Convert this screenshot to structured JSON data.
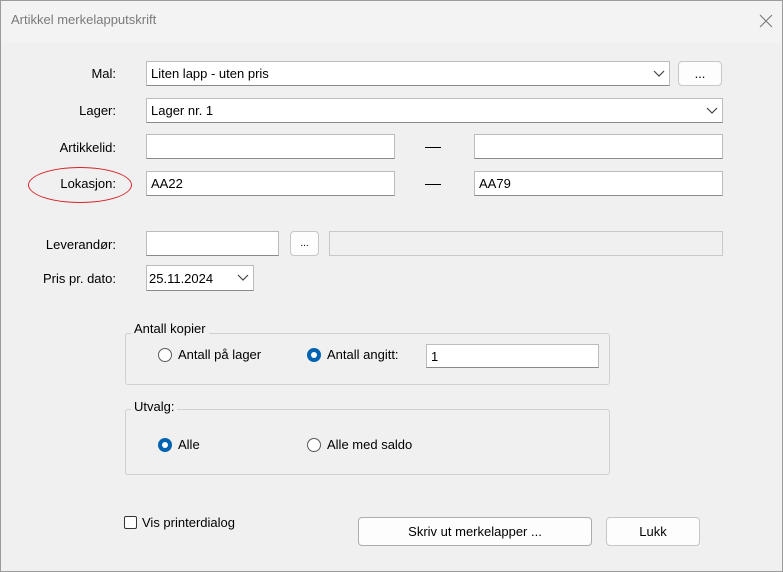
{
  "window": {
    "title": "Artikkel merkelapputskrift",
    "close_icon": "close-icon"
  },
  "form": {
    "mal": {
      "label": "Mal:",
      "value": "Liten lapp - uten pris",
      "browse_label": "..."
    },
    "lager": {
      "label": "Lager:",
      "value": "Lager nr. 1"
    },
    "artikkelid": {
      "label": "Artikkelid:",
      "from": "",
      "to": ""
    },
    "lokasjon": {
      "label": "Lokasjon:",
      "from": "AA22",
      "to": "AA79"
    },
    "leverandor": {
      "label": "Leverandør:",
      "value": "",
      "browse_label": "...",
      "name": ""
    },
    "pris_dato": {
      "label": "Pris pr. dato:",
      "value": "25.11.2024"
    }
  },
  "antall_kopier": {
    "legend": "Antall kopier",
    "option_lager": "Antall på lager",
    "option_angitt": "Antall angitt:",
    "selected": "angitt",
    "angitt_value": "1"
  },
  "utvalg": {
    "legend": "Utvalg:",
    "option_alle": "Alle",
    "option_saldo": "Alle med saldo",
    "selected": "alle"
  },
  "footer": {
    "vis_printerdialog": "Vis printerdialog",
    "checked": false,
    "print_button": "Skriv ut merkelapper ...",
    "close_button": "Lukk"
  },
  "colors": {
    "accent": "#0063b1",
    "highlight": "#d6252b",
    "background": "#f0f0f0"
  }
}
